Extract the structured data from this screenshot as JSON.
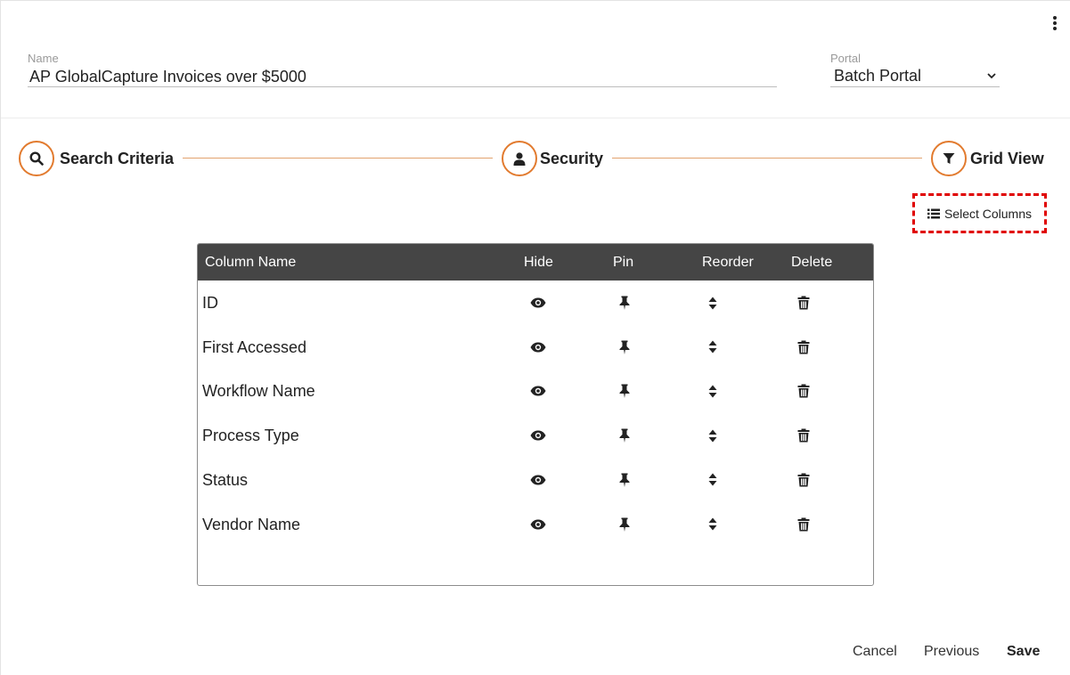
{
  "form": {
    "name_label": "Name",
    "name_value": "AP GlobalCapture Invoices over $5000",
    "portal_label": "Portal",
    "portal_value": "Batch Portal"
  },
  "steps": [
    {
      "label": "Search Criteria",
      "icon": "search-icon"
    },
    {
      "label": "Security",
      "icon": "user-icon"
    },
    {
      "label": "Grid View",
      "icon": "filter-icon"
    }
  ],
  "select_columns_label": "Select Columns",
  "grid": {
    "headers": {
      "column_name": "Column Name",
      "hide": "Hide",
      "pin": "Pin",
      "reorder": "Reorder",
      "delete": "Delete"
    },
    "rows": [
      {
        "name": "ID"
      },
      {
        "name": "First Accessed"
      },
      {
        "name": "Workflow Name"
      },
      {
        "name": "Process Type"
      },
      {
        "name": "Status"
      },
      {
        "name": "Vendor Name"
      }
    ]
  },
  "footer": {
    "cancel": "Cancel",
    "previous": "Previous",
    "save": "Save"
  },
  "colors": {
    "accent": "#e27b2f",
    "header_bg": "#454545",
    "highlight_border": "#e00000"
  }
}
